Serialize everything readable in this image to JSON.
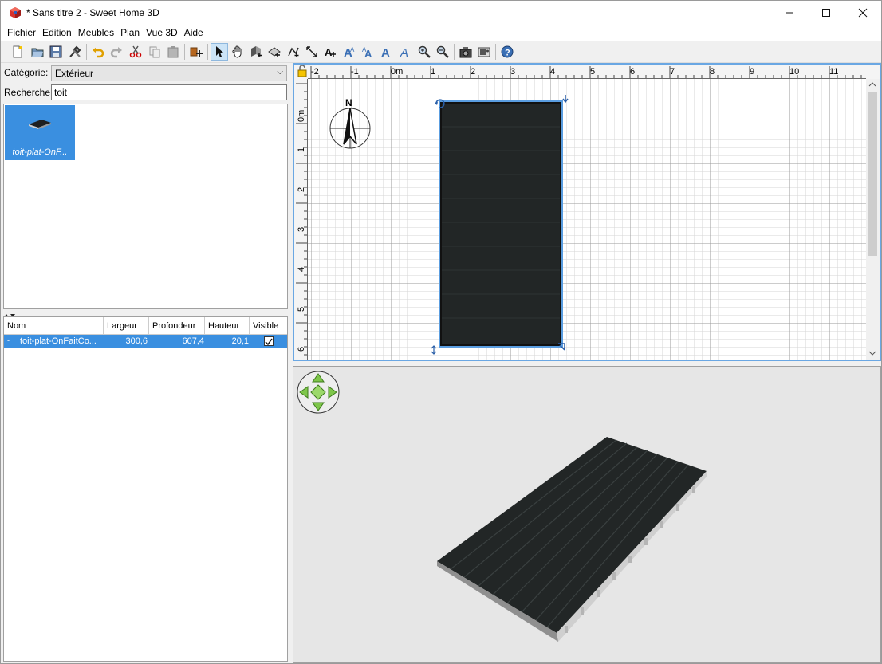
{
  "window": {
    "title": "* Sans titre 2 - Sweet Home 3D"
  },
  "menu": [
    "Fichier",
    "Edition",
    "Meubles",
    "Plan",
    "Vue 3D",
    "Aide"
  ],
  "toolbar": {
    "icons": [
      "new-file-icon",
      "open-folder-icon",
      "save-icon",
      "preferences-icon",
      "undo-icon",
      "redo-icon",
      "cut-icon",
      "copy-icon",
      "paste-icon",
      "add-furniture-icon",
      "select-arrow-icon",
      "pan-hand-icon",
      "create-walls-icon",
      "create-rooms-icon",
      "create-polylines-icon",
      "create-dimensions-icon",
      "add-text-icon",
      "increase-text-icon",
      "decrease-text-icon",
      "bold-text-icon",
      "italic-text-icon",
      "zoom-in-icon",
      "zoom-out-icon",
      "create-photo-icon",
      "create-video-icon",
      "help-icon"
    ]
  },
  "catalog": {
    "category_label": "Catégorie:",
    "category_value": "Extérieur",
    "search_label": "Recherche:",
    "search_value": "toit",
    "items": [
      {
        "label": "toit-plat-OnF..."
      }
    ]
  },
  "furniture_table": {
    "headers": [
      "Nom",
      "Largeur",
      "Profondeur",
      "Hauteur",
      "Visible"
    ],
    "rows": [
      {
        "name": "toit-plat-OnFaitCo...",
        "largeur": "300,6",
        "profondeur": "607,4",
        "hauteur": "20,1",
        "visible": true
      }
    ]
  },
  "plan": {
    "ruler_x": [
      "-2",
      "-1",
      "0m",
      "1",
      "2",
      "3",
      "4",
      "5",
      "6",
      "7",
      "8",
      "9",
      "10",
      "11"
    ],
    "ruler_y": [
      "0m",
      "1",
      "2",
      "3",
      "4",
      "5",
      "6"
    ],
    "compass_label": "N"
  },
  "colors": {
    "selection": "#3a8fe0",
    "roof": "#222626",
    "plan_border": "#6aa7e3"
  }
}
